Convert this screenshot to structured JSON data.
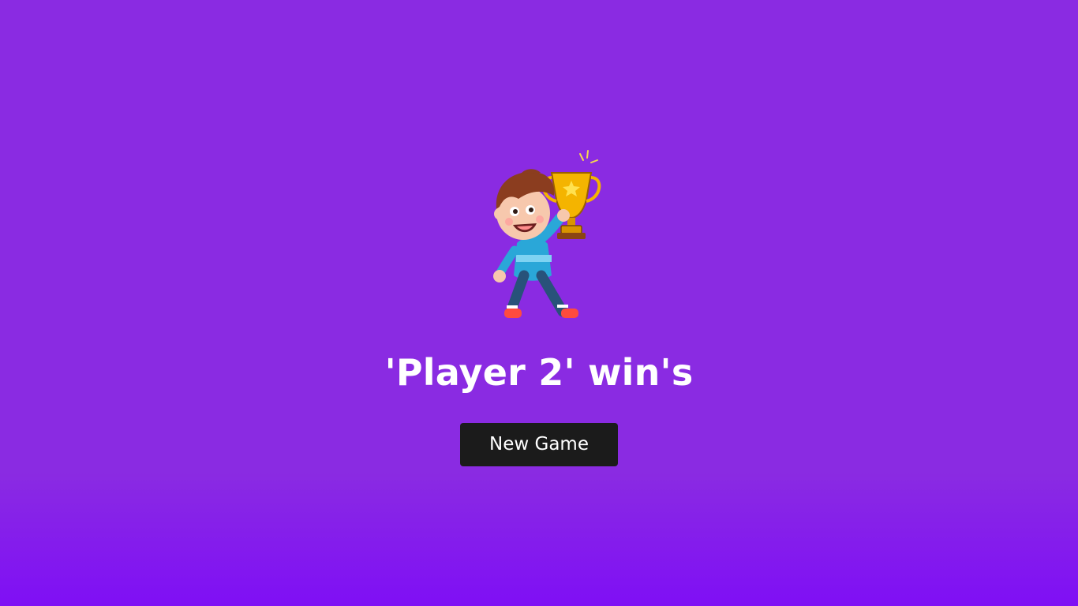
{
  "game": {
    "result_message": "'Player 2' win's",
    "new_game_label": "New Game"
  },
  "illustration": {
    "name": "winner-boy-trophy-illustration"
  },
  "colors": {
    "background": "#8a2be2",
    "button_background": "#1b1b1b",
    "text": "#ffffff"
  }
}
